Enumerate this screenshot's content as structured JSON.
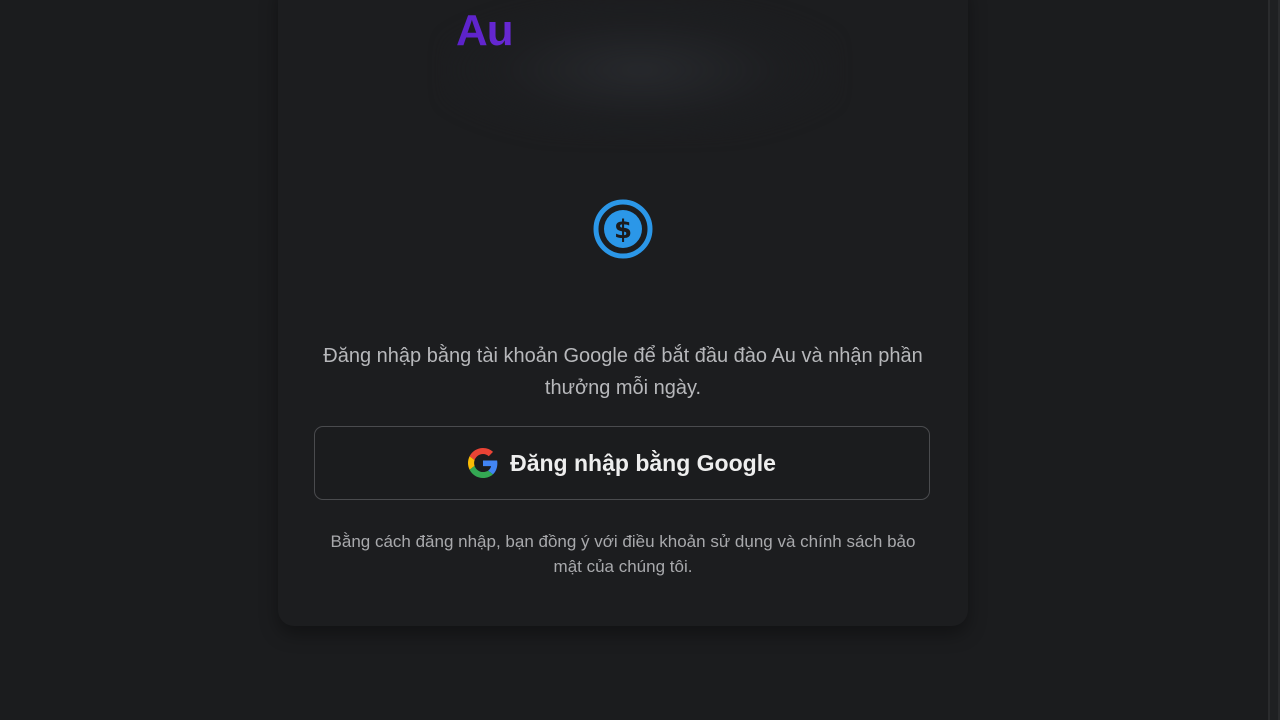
{
  "brand": {
    "text": "Au"
  },
  "icons": {
    "coin": "dollar-coin-icon",
    "google": "google-g-icon"
  },
  "colors": {
    "background": "#1b1c1e",
    "accent_blue": "#2b97e8",
    "brand_purple": "#5b22c9"
  },
  "login": {
    "description": "Đăng nhập bằng tài khoản Google để bắt đầu đào Au và nhận phần thưởng mỗi ngày.",
    "google_button_label": "Đăng nhập bằng Google",
    "terms": "Bằng cách đăng nhập, bạn đồng ý với điều khoản sử dụng và chính sách bảo mật của chúng tôi."
  }
}
